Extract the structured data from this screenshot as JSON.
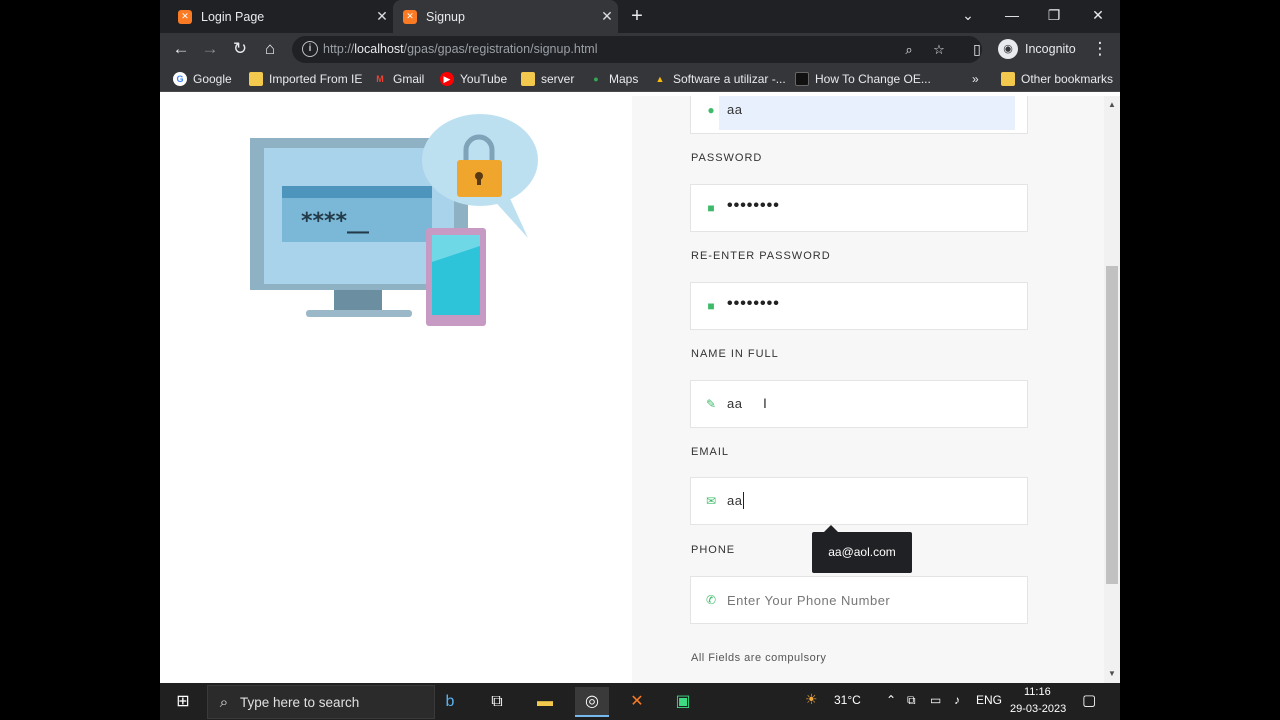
{
  "browser": {
    "tabs": [
      {
        "title": "Login Page",
        "favicon": "xampp-icon",
        "active": false
      },
      {
        "title": "Signup",
        "favicon": "xampp-icon",
        "active": true
      }
    ],
    "url_prefix": "http://",
    "url_host": "localhost",
    "url_path": "/gpas/gpas/registration/signup.html",
    "profile_label": "Incognito",
    "bookmarks": [
      {
        "label": "Google",
        "icon": "google-icon"
      },
      {
        "label": "Imported From IE",
        "icon": "folder-icon"
      },
      {
        "label": "Gmail",
        "icon": "gmail-icon"
      },
      {
        "label": "YouTube",
        "icon": "youtube-icon"
      },
      {
        "label": "server",
        "icon": "folder-icon"
      },
      {
        "label": "Maps",
        "icon": "maps-icon"
      },
      {
        "label": "Software a utilizar -...",
        "icon": "drive-icon"
      },
      {
        "label": "How To Change OE...",
        "icon": "page-icon"
      }
    ],
    "other_bookmarks": "Other bookmarks"
  },
  "form": {
    "username_value": "aa",
    "password_label": "PASSWORD",
    "password_value": "••••••••",
    "reenter_label": "RE-ENTER PASSWORD",
    "reenter_value": "••••••••",
    "name_label": "NAME IN FULL",
    "name_value": "aa",
    "email_label": "EMAIL",
    "email_value": "aa",
    "email_suggestion": "aa@aol.com",
    "phone_label": "PHONE",
    "phone_placeholder": "Enter Your Phone Number",
    "footer_note": "All Fields are compulsory"
  },
  "illustration": {
    "masked_text": "****__"
  },
  "taskbar": {
    "search_placeholder": "Type here to search",
    "weather": "31°C",
    "language": "ENG",
    "time": "11:16",
    "date": "29-03-2023"
  },
  "colors": {
    "accent_green": "#3dbb6a",
    "tab_bg": "#202124",
    "toolbar_bg": "#35363a"
  }
}
